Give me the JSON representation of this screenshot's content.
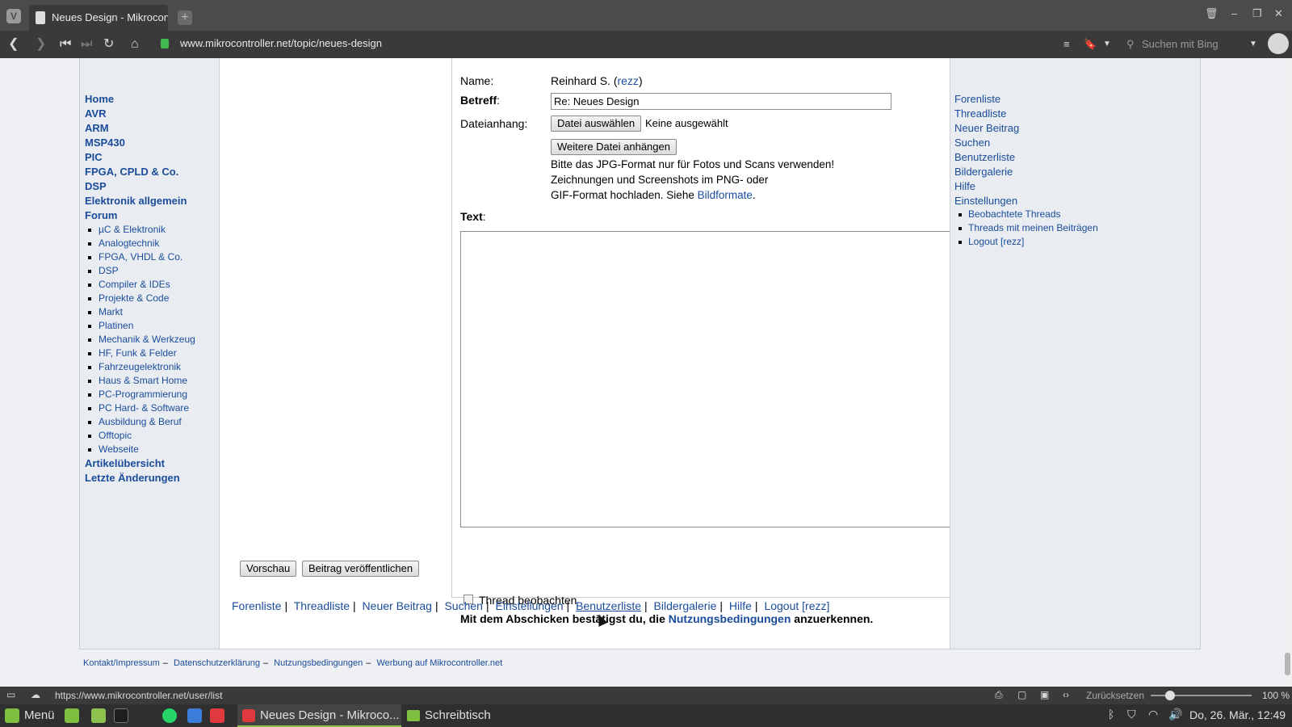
{
  "browser": {
    "tab_title": "Neues Design - Mikrocontr",
    "url": "www.mikrocontroller.net/topic/neues-design",
    "search_placeholder": "Suchen mit Bing"
  },
  "left_nav": {
    "top": [
      "Home",
      "AVR",
      "ARM",
      "MSP430",
      "PIC",
      "FPGA, CPLD & Co.",
      "DSP",
      "Elektronik allgemein",
      "Forum"
    ],
    "forums": [
      "µC & Elektronik",
      "Analogtechnik",
      "FPGA, VHDL & Co.",
      "DSP",
      "Compiler & IDEs",
      "Projekte & Code",
      "Markt",
      "Platinen",
      "Mechanik & Werkzeug",
      "HF, Funk & Felder",
      "Fahrzeugelektronik",
      "Haus & Smart Home",
      "PC-Programmierung",
      "PC Hard- & Software",
      "Ausbildung & Beruf",
      "Offtopic",
      "Webseite"
    ],
    "bottom": [
      "Artikelübersicht",
      "Letzte Änderungen"
    ]
  },
  "right_nav": {
    "items": [
      "Forenliste",
      "Threadliste",
      "Neuer Beitrag",
      "Suchen",
      "Benutzerliste",
      "Bildergalerie",
      "Hilfe",
      "Einstellungen"
    ],
    "sub_items": [
      "Beobachtete Threads",
      "Threads mit meinen Beiträgen",
      "Logout [rezz]"
    ]
  },
  "form": {
    "name_label": "Name:",
    "name_value": "Reinhard S. (",
    "name_link": "rezz",
    "name_close": ")",
    "subject_label": "Betreff",
    "subject_colon": ":",
    "subject_value": "Re: Neues Design",
    "attachment_label": "Dateianhang:",
    "choose_file_button": "Datei auswählen",
    "no_file_text": "Keine ausgewählt",
    "add_file_button": "Weitere Datei anhängen",
    "hint_line1": "Bitte das JPG-Format nur für Fotos und Scans verwenden!",
    "hint_line2": "Zeichnungen und Screenshots im PNG- oder",
    "hint_line3": "GIF-Format hochladen. Siehe ",
    "hint_link": "Bildformate",
    "hint_end": ".",
    "text_label": "Text",
    "text_colon": ":",
    "watch_label": "Thread beobachten",
    "terms_prefix": "Mit dem Abschicken bestätigst du, die ",
    "terms_link": "Nutzungsbedingungen",
    "terms_suffix": " anzuerkennen.",
    "preview_button": "Vorschau",
    "publish_button": "Beitrag veröffentlichen"
  },
  "footer_links": [
    "Forenliste",
    "Threadliste",
    "Neuer Beitrag",
    "Suchen",
    "Einstellungen",
    "Benutzerliste",
    "Bildergalerie",
    "Hilfe",
    "Logout [rezz]"
  ],
  "site_footer": [
    "Kontakt/Impressum",
    "Datenschutzerklärung",
    "Nutzungsbedingungen",
    "Werbung auf Mikrocontroller.net"
  ],
  "statusbar": {
    "hover_url": "https://www.mikrocontroller.net/user/list",
    "zoom_reset": "Zurücksetzen",
    "zoom_value": "100 %"
  },
  "taskbar": {
    "menu": "Menü",
    "browser_window": "Neues Design - Mikroco...",
    "desktop": "Schreibtisch",
    "clock": "Do, 26. Mär., 12:49"
  }
}
